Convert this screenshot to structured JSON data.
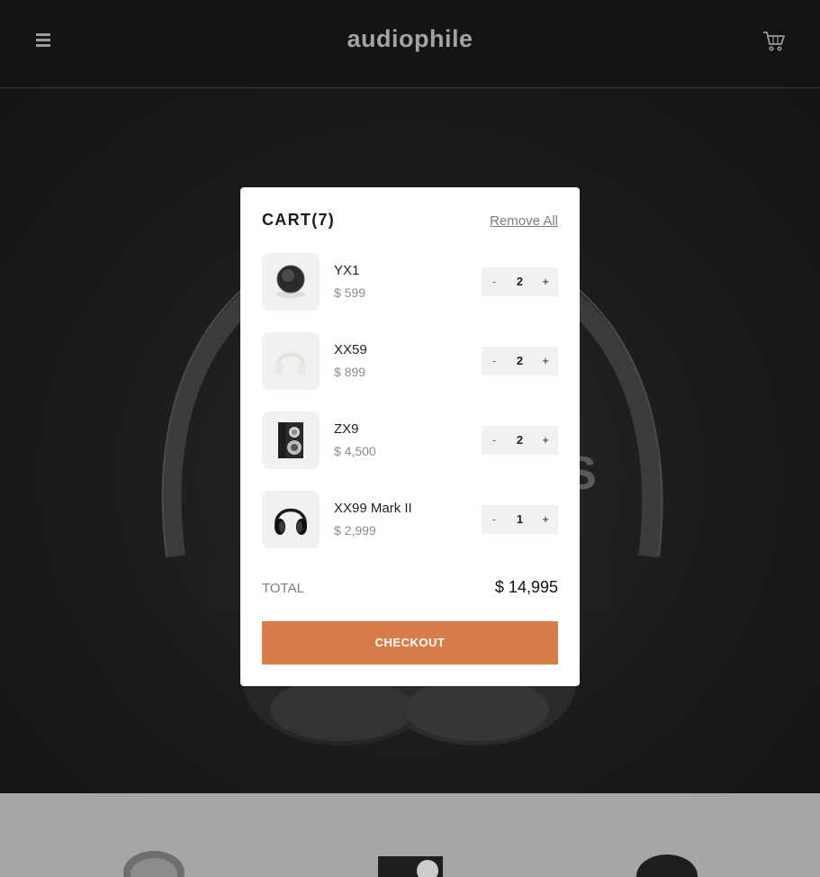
{
  "header": {
    "logo": "audiophile",
    "menu_icon": "hamburger-menu-icon",
    "cart_icon": "shopping-cart-icon"
  },
  "hero": {
    "partial_text": "S"
  },
  "cart": {
    "title": "CART(7)",
    "remove_all": "Remove All",
    "items": [
      {
        "name": "YX1",
        "price": "$ 599",
        "quantity": "2",
        "image": "yx1-earphones"
      },
      {
        "name": "XX59",
        "price": "$ 899",
        "quantity": "2",
        "image": "xx59-headphones"
      },
      {
        "name": "ZX9",
        "price": "$ 4,500",
        "quantity": "2",
        "image": "zx9-speaker"
      },
      {
        "name": "XX99 Mark II",
        "price": "$ 2,999",
        "quantity": "1",
        "image": "xx99-mark-ii-headphones"
      }
    ],
    "minus_label": "-",
    "plus_label": "+",
    "total_label": "TOTAL",
    "total_value": "$ 14,995",
    "checkout_label": "CHECKOUT"
  },
  "colors": {
    "accent": "#d87d4a",
    "header_bg": "#131313",
    "overlay_strip": "#a6a6a6"
  }
}
